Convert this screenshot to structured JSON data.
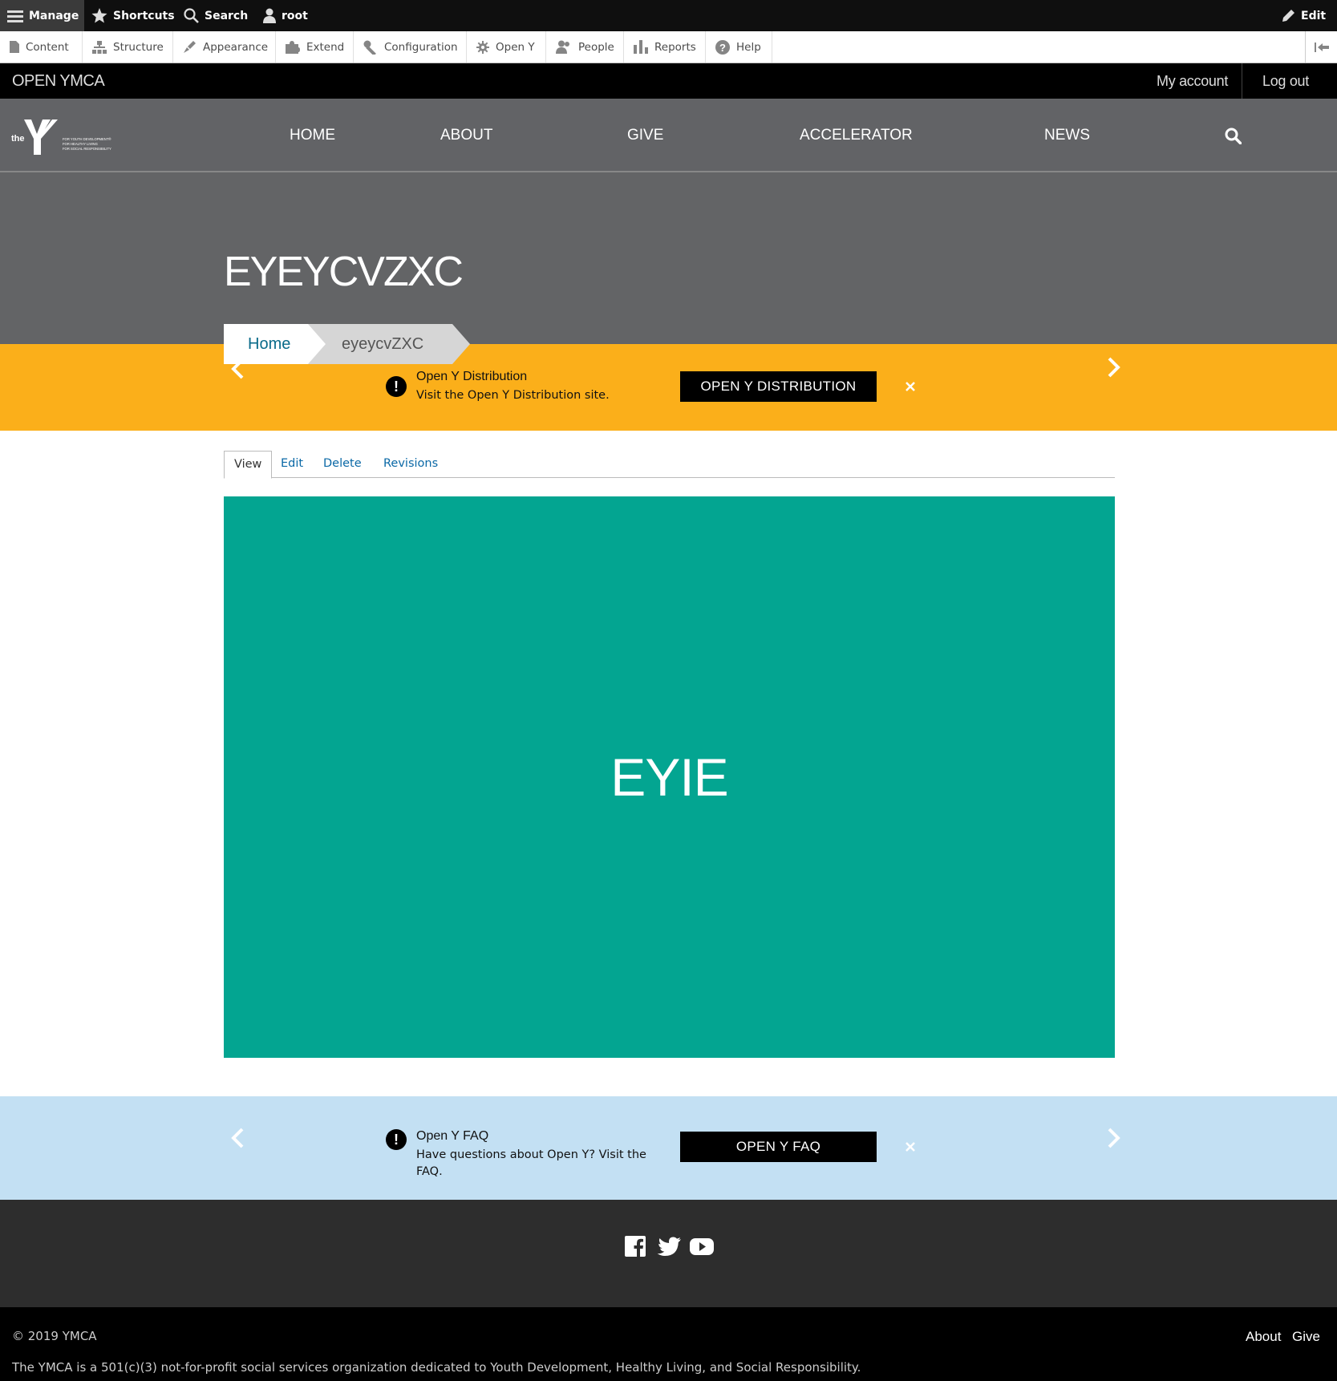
{
  "admin_toolbar": {
    "manage": "Manage",
    "shortcuts": "Shortcuts",
    "search": "Search",
    "user": "root",
    "edit": "Edit"
  },
  "admin_tray": {
    "items": [
      "Content",
      "Structure",
      "Appearance",
      "Extend",
      "Configuration",
      "Open Y",
      "People",
      "Reports",
      "Help"
    ]
  },
  "site_top": {
    "brand": "OPEN YMCA",
    "my_account": "My account",
    "log_out": "Log out"
  },
  "main_nav": {
    "logo_text": "the",
    "logo_tagline": [
      "FOR YOUTH DEVELOPMENT®",
      "FOR HEALTHY LIVING",
      "FOR SOCIAL RESPONSIBILITY"
    ],
    "links": [
      "HOME",
      "ABOUT",
      "GIVE",
      "ACCELERATOR",
      "NEWS"
    ]
  },
  "hero": {
    "title": "EYEYCVZXC"
  },
  "breadcrumb": {
    "home": "Home",
    "current": "eyeycvZXC"
  },
  "alert_top": {
    "title": "Open Y Distribution",
    "description": "Visit the Open Y Distribution site.",
    "button": "OPEN Y DISTRIBUTION",
    "color": "#fbaf1a"
  },
  "tabs": [
    "View",
    "Edit",
    "Delete",
    "Revisions"
  ],
  "banner": {
    "heading": "EYIE",
    "color": "#03a591"
  },
  "alert_bottom": {
    "title": "Open Y FAQ",
    "description": "Have questions about Open Y? Visit the FAQ.",
    "button": "OPEN Y FAQ",
    "color": "#c3e0f3"
  },
  "footer": {
    "social_icons": [
      "facebook-icon",
      "twitter-icon",
      "youtube-icon"
    ],
    "copyright": "© 2019 YMCA",
    "mission": "The YMCA is a 501(c)(3) not-for-profit social services organization dedicated to Youth Development, Healthy Living, and Social Responsibility.",
    "links": [
      "About",
      "Give"
    ]
  }
}
